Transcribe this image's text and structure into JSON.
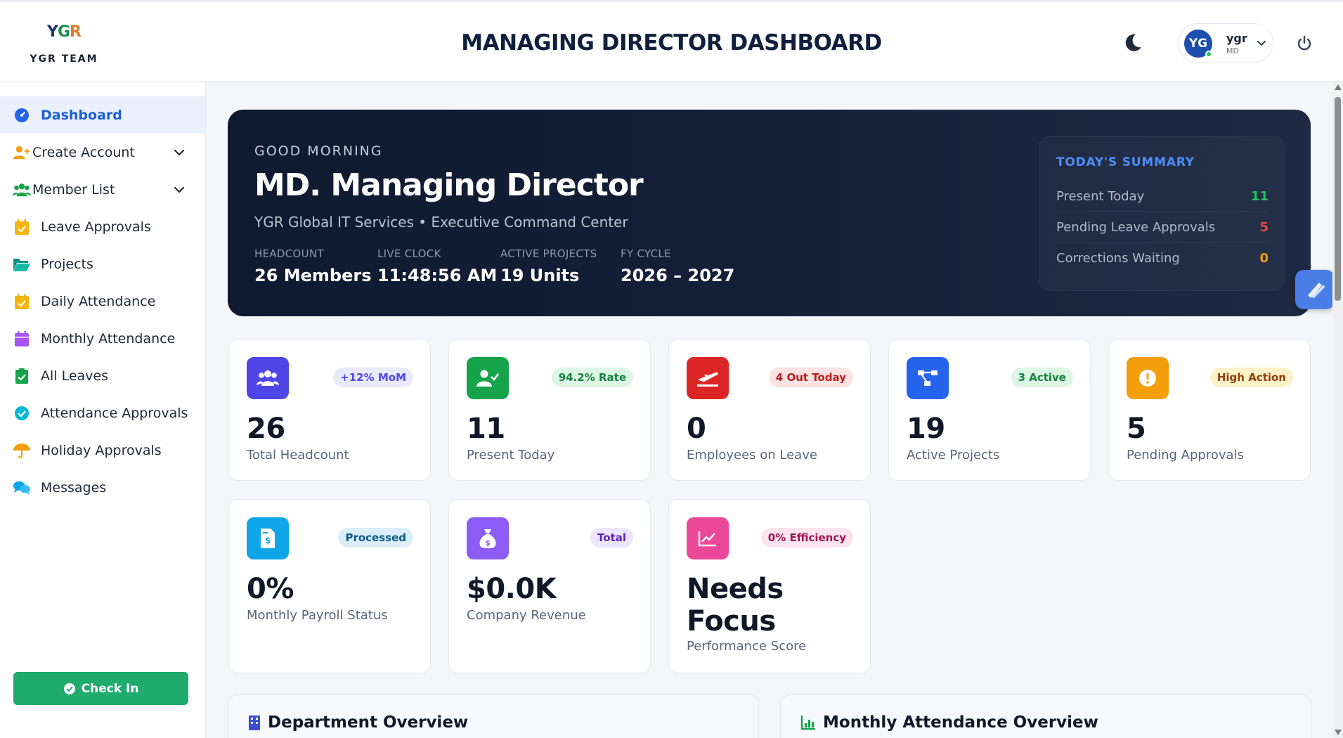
{
  "header": {
    "logo_text": "YGR",
    "team": "YGR TEAM",
    "title": "MANAGING DIRECTOR DASHBOARD",
    "user": {
      "initials": "YG",
      "name": "ygr",
      "role": "MD"
    }
  },
  "sidebar": {
    "items": [
      {
        "label": "Dashboard",
        "icon": "gauge-icon",
        "active": true
      },
      {
        "label": "Create Account",
        "icon": "user-plus-icon",
        "expandable": true
      },
      {
        "label": "Member List",
        "icon": "users-icon",
        "expandable": true
      },
      {
        "label": "Leave Approvals",
        "icon": "calendar-check-icon"
      },
      {
        "label": "Projects",
        "icon": "folder-open-icon"
      },
      {
        "label": "Daily Attendance",
        "icon": "calendar-check-icon"
      },
      {
        "label": "Monthly Attendance",
        "icon": "calendar-icon"
      },
      {
        "label": "All Leaves",
        "icon": "clipboard-check-icon"
      },
      {
        "label": "Attendance Approvals",
        "icon": "check-circle-icon"
      },
      {
        "label": "Holiday Approvals",
        "icon": "umbrella-icon"
      },
      {
        "label": "Messages",
        "icon": "chat-icon"
      }
    ],
    "checkin_label": "Check In"
  },
  "hero": {
    "greeting": "GOOD MORNING",
    "name": "MD. Managing Director",
    "subtitle": "YGR Global IT Services • Executive Command Center",
    "stats": [
      {
        "label": "HEADCOUNT",
        "value": "26 Members"
      },
      {
        "label": "LIVE CLOCK",
        "value": "11:48:56 AM"
      },
      {
        "label": "ACTIVE PROJECTS",
        "value": "19 Units"
      },
      {
        "label": "FY CYCLE",
        "value": "2026 – 2027"
      }
    ],
    "summary": {
      "title": "TODAY'S SUMMARY",
      "rows": [
        {
          "label": "Present Today",
          "value": "11",
          "color": "#22c55e"
        },
        {
          "label": "Pending Leave Approvals",
          "value": "5",
          "color": "#ef4444"
        },
        {
          "label": "Corrections Waiting",
          "value": "0",
          "color": "#f59e0b"
        }
      ]
    }
  },
  "cards": [
    {
      "value": "26",
      "label": "Total Headcount",
      "badge": "+12% MoM",
      "icon": "users-icon",
      "color": "#4f46e5"
    },
    {
      "value": "11",
      "label": "Present Today",
      "badge": "94.2% Rate",
      "icon": "user-check-icon",
      "color": "#16a34a"
    },
    {
      "value": "0",
      "label": "Employees on Leave",
      "badge": "4 Out Today",
      "icon": "plane-departure-icon",
      "color": "#dc2626"
    },
    {
      "value": "19",
      "label": "Active Projects",
      "badge": "3 Active",
      "icon": "project-diagram-icon",
      "color": "#2563eb"
    },
    {
      "value": "5",
      "label": "Pending Approvals",
      "badge": "High Action",
      "icon": "alert-circle-icon",
      "color": "#f59e0b"
    },
    {
      "value": "0%",
      "label": "Monthly Payroll Status",
      "badge": "Processed",
      "icon": "invoice-dollar-icon",
      "color": "#0ea5e9"
    },
    {
      "value": "$0.0K",
      "label": "Company Revenue",
      "badge": "Total",
      "icon": "money-bag-icon",
      "color": "#8b5cf6"
    },
    {
      "value_line1": "Needs",
      "value_line2": "Focus",
      "label": "Performance Score",
      "badge": "0% Efficiency",
      "icon": "chart-line-icon",
      "color": "#ec4899"
    }
  ],
  "panels": [
    {
      "title": "Department Overview",
      "icon": "building-icon"
    },
    {
      "title": "Monthly Attendance Overview",
      "icon": "chart-bar-icon"
    }
  ]
}
